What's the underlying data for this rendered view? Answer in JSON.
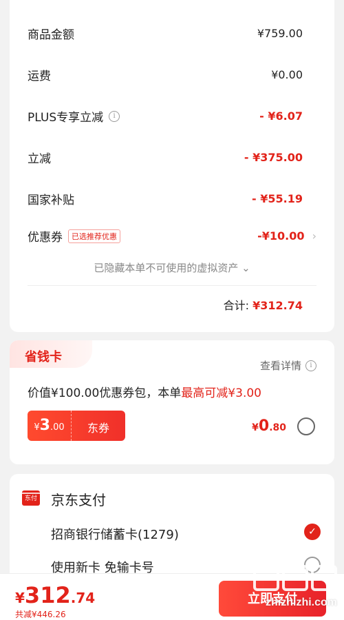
{
  "summary": {
    "rows": [
      {
        "label": "商品金额",
        "value": "¥759.00"
      },
      {
        "label": "运费",
        "value": "¥0.00"
      },
      {
        "label": "PLUS专享立减",
        "value": "- ¥6.07"
      },
      {
        "label": "立减",
        "value": "- ¥375.00"
      },
      {
        "label": "国家补贴",
        "value": "- ¥55.19"
      },
      {
        "label": "优惠券",
        "tag": "已选推荐优惠",
        "value": "-¥10.00"
      }
    ],
    "hidden_note": "已隐藏本单不可使用的虚拟资产 ⌄",
    "total_label": "合计:",
    "total_value": "¥312.74"
  },
  "savings": {
    "badge": "省钱卡",
    "detail": "查看详情",
    "desc_prefix": "价值¥100.00优惠券包，本单",
    "desc_highlight": "最高可减¥3.00",
    "coupon": {
      "yen": "¥",
      "int": "3",
      "dec": ".00",
      "type": "东券"
    },
    "price": {
      "yen": "¥",
      "int": "0",
      "dec": ".80"
    }
  },
  "payment": {
    "icon_text": "东付",
    "title": "京东支付",
    "options": [
      "招商银行储蓄卡(1279)",
      "使用新卡 免输卡号"
    ]
  },
  "bottom": {
    "price": {
      "yen": "¥",
      "int": "312",
      "dec": ".74"
    },
    "saved": "共减¥446.26",
    "pay_button": "立即支付"
  },
  "watermark": {
    "text": "zhizhizhi.com"
  },
  "colors": {
    "accent": "#e2231a",
    "background": "#f2f2f2"
  }
}
